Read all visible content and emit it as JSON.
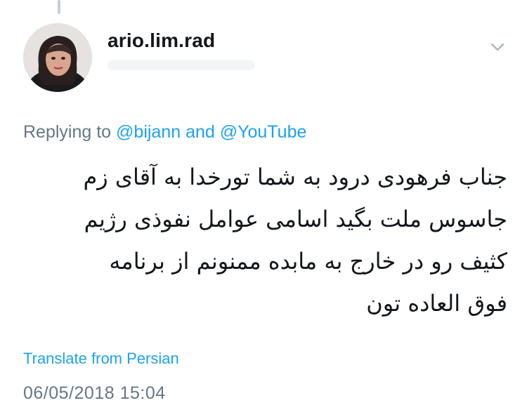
{
  "tweet": {
    "username": "ario.lim.rad",
    "replying_prefix": "Replying to",
    "mention_1": "@bijann",
    "conjunction": "and",
    "mention_2": "@YouTube",
    "text_lines": [
      "جناب فرهودی درود به شما تورخدا به آقای زم",
      "جاسوس ملت بگید اسامی عوامل نفوذی رژیم",
      "کثیف رو در خارج به مابده ممنونم از برنامه",
      "فوق العاده تون"
    ],
    "translate_label": "Translate from Persian",
    "timestamp": "06/05/2018 15:04"
  },
  "icons": {
    "menu": "chevron-down-icon",
    "avatar": "profile-photo"
  },
  "colors": {
    "link": "#1da1f2",
    "secondary_text": "#657786",
    "primary_text": "#14171a"
  }
}
